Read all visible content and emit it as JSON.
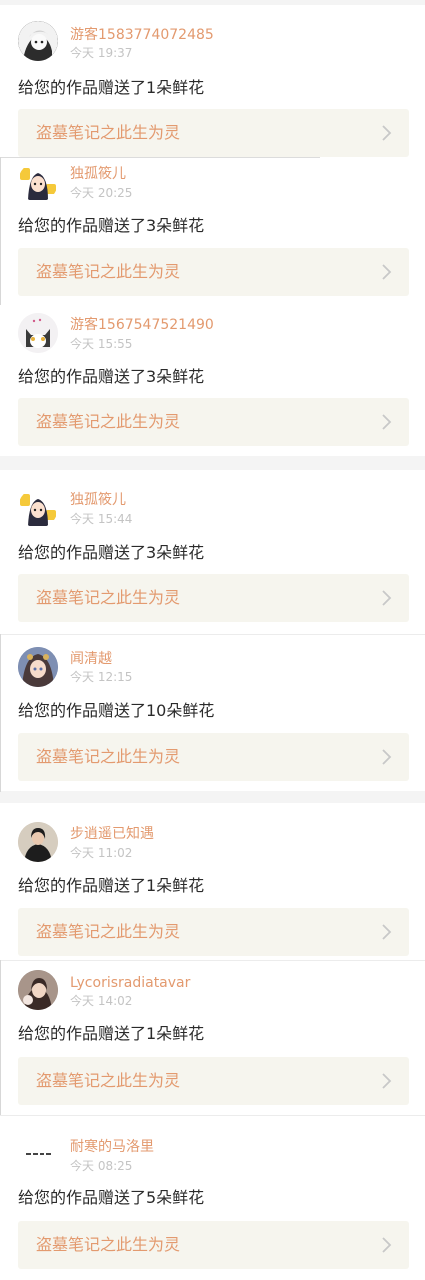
{
  "colors": {
    "username": "#e39a6f",
    "work_title": "#e39a6f",
    "timestamp": "#c4c4c4",
    "message": "#2b2b2b",
    "link_bg": "#f6f5ee",
    "separator": "#f4f4f4"
  },
  "notifications": [
    {
      "username": "游客1583774072485",
      "time": "今天 19:37",
      "message": "给您的作品赠送了1朵鲜花",
      "work_title": "盗墓笔记之此生为灵",
      "avatar_icon": "anime-boy-avatar-icon"
    },
    {
      "username": "独孤筱儿",
      "time": "今天 20:25",
      "message": "给您的作品赠送了3朵鲜花",
      "work_title": "盗墓笔记之此生为灵",
      "avatar_icon": "cartoon-girl-avatar-icon"
    },
    {
      "username": "游客1567547521490",
      "time": "今天 15:55",
      "message": "给您的作品赠送了3朵鲜花",
      "work_title": "盗墓笔记之此生为灵",
      "avatar_icon": "cat-avatar-icon"
    },
    {
      "username": "独孤筱儿",
      "time": "今天 15:44",
      "message": "给您的作品赠送了3朵鲜花",
      "work_title": "盗墓笔记之此生为灵",
      "avatar_icon": "cartoon-girl-avatar-icon"
    },
    {
      "username": "闻清越",
      "time": "今天 12:15",
      "message": "给您的作品赠送了10朵鲜花",
      "work_title": "盗墓笔记之此生为灵",
      "avatar_icon": "anime-girl-avatar-icon"
    },
    {
      "username": "步逍遥已知遇",
      "time": "今天 11:02",
      "message": "给您的作品赠送了1朵鲜花",
      "work_title": "盗墓笔记之此生为灵",
      "avatar_icon": "photo-portrait-avatar-icon"
    },
    {
      "username": "Lycorisradiatavar",
      "time": "今天 14:02",
      "message": "给您的作品赠送了1朵鲜花",
      "work_title": "盗墓笔记之此生为灵",
      "avatar_icon": "photo-girl-avatar-icon"
    },
    {
      "username": "耐寒的马洛里",
      "time": "今天 08:25",
      "message": "给您的作品赠送了5朵鲜花",
      "work_title": "盗墓笔记之此生为灵",
      "avatar_icon": "text-logo-avatar-icon"
    }
  ]
}
